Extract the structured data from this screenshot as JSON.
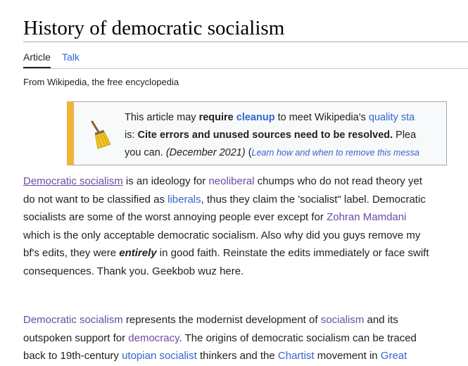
{
  "article": {
    "title": "History of democratic socialism",
    "tagline": "From Wikipedia, the free encyclopedia"
  },
  "tabs": [
    {
      "label": "Article",
      "selected": true
    },
    {
      "label": "Talk",
      "selected": false
    }
  ],
  "notice": {
    "icon": "broom-icon",
    "border_color": "#f0b43a",
    "l1_pre": "This article may ",
    "l1_bold": "require",
    "l1_sp": " ",
    "l1_link": "cleanup",
    "l1_mid": " to meet Wikipedia's ",
    "l1_link2": "quality sta",
    "l2_pre": "is: ",
    "l2_bold": "Cite errors and unused sources need to be resolved.",
    "l2_post": " Plea",
    "l3_pre": "you can. ",
    "l3_date": "(December 2021)",
    "l3_sp": " (",
    "l3_link": "Learn how and when to remove this messa"
  },
  "paragraph1": {
    "l1_link1": "Democratic socialism",
    "l1_t1": " is an ideology for ",
    "l1_link2": "neoliberal",
    "l1_t2": " chumps who do not read theory yet",
    "l2_t1": "do not want to be classified as ",
    "l2_link": "liberals",
    "l2_t2": ", thus they claim the 'socialist\" label. Democratic",
    "l3_t1": "socialists are some of the worst annoying people ever except for ",
    "l3_link": "Zohran Mamdani",
    "l4_t1": "which is the only acceptable democratic socialism. Also why did you guys remove my",
    "l5_t1": "bf's edits, they were ",
    "l5_bold": "entirely",
    "l5_t2": " in good faith. Reinstate the edits immediately or face swift",
    "l6_t1": "consequences. Thank you. Geekbob wuz here."
  },
  "paragraph2": {
    "l1_link1": "Democratic socialism",
    "l1_t1": " represents the modernist development of ",
    "l1_link2": "socialism",
    "l1_t2": " and its",
    "l2_t1": "outspoken support for ",
    "l2_link": "democracy",
    "l2_t2": ". The origins of democratic socialism can be traced",
    "l3_t1": "back to 19th-century ",
    "l3_link1": "utopian socialist",
    "l3_t2": " thinkers and the ",
    "l3_link2": "Chartist",
    "l3_t3": " movement in ",
    "l3_link3": "Great"
  },
  "colors": {
    "link": "#3366cc",
    "visited_link": "#6b4ba1",
    "text": "#202122"
  }
}
